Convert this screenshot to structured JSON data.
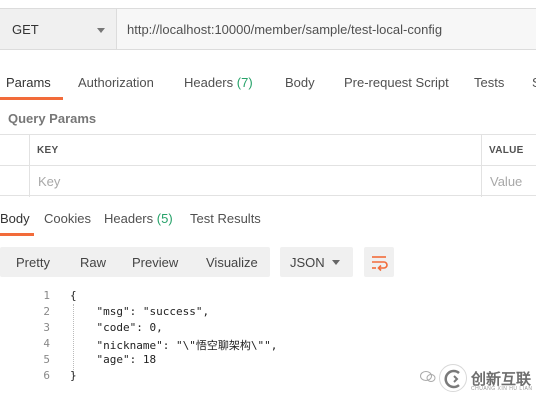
{
  "request": {
    "method": "GET",
    "url": "http://localhost:10000/member/sample/test-local-config"
  },
  "request_tabs": [
    {
      "label": "Params",
      "count": ""
    },
    {
      "label": "Authorization",
      "count": ""
    },
    {
      "label": "Headers",
      "count": "(7)"
    },
    {
      "label": "Body",
      "count": ""
    },
    {
      "label": "Pre-request Script",
      "count": ""
    },
    {
      "label": "Tests",
      "count": ""
    },
    {
      "label": "S",
      "count": ""
    }
  ],
  "query_params": {
    "title": "Query Params",
    "key_header": "KEY",
    "value_header": "VALUE",
    "key_placeholder": "Key",
    "value_placeholder": "Value"
  },
  "response_tabs": [
    {
      "label": "Body",
      "count": ""
    },
    {
      "label": "Cookies",
      "count": ""
    },
    {
      "label": "Headers",
      "count": "(5)"
    },
    {
      "label": "Test Results",
      "count": ""
    }
  ],
  "response_toolbar": {
    "formats": [
      "Pretty",
      "Raw",
      "Preview",
      "Visualize"
    ],
    "language": "JSON"
  },
  "response_body": [
    {
      "num": "1",
      "text": "{"
    },
    {
      "num": "2",
      "text": "    \"msg\": \"success\","
    },
    {
      "num": "3",
      "text": "    \"code\": 0,"
    },
    {
      "num": "4",
      "text": "    \"nickname\": \"\\\"悟空聊架构\\\"\","
    },
    {
      "num": "5",
      "text": "    \"age\": 18"
    },
    {
      "num": "6",
      "text": "}"
    }
  ],
  "watermark": {
    "brand": "创新互联",
    "subtitle": "CHUANG XIN HU LIAN"
  },
  "colors": {
    "accent": "#f26b3a",
    "count_green": "#26a269"
  }
}
